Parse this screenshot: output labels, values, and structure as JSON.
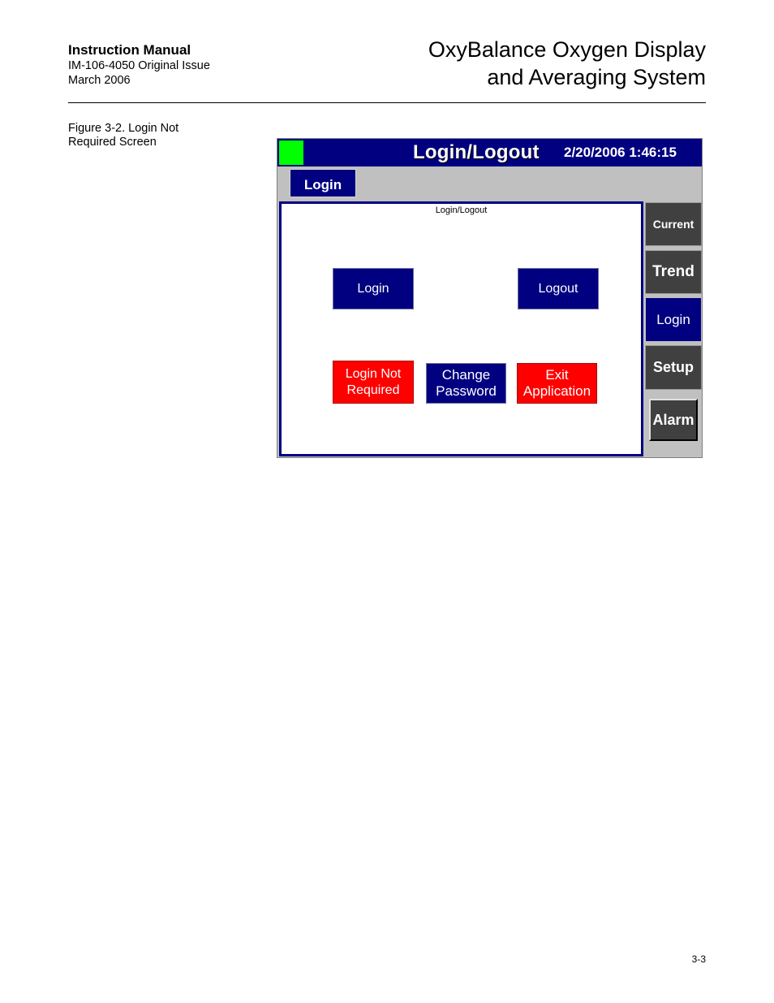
{
  "header": {
    "manual": "Instruction Manual",
    "doc_id": "IM-106-4050 Original Issue",
    "date": "March 2006",
    "title_line1": "OxyBalance Oxygen Display",
    "title_line2": "and Averaging System"
  },
  "figure": {
    "caption_line1": "Figure 3-2. Login Not",
    "caption_line2": "Required Screen"
  },
  "screen": {
    "title": "Login/Logout",
    "datetime": "2/20/2006 1:46:15",
    "tab_label": "Login",
    "panel_title": "Login/Logout",
    "buttons": {
      "login": "Login",
      "logout": "Logout",
      "login_not_required_1": "Login Not",
      "login_not_required_2": "Required",
      "change_password_1": "Change",
      "change_password_2": "Password",
      "exit_application_1": "Exit",
      "exit_application_2": "Application"
    },
    "nav": {
      "current": "Current",
      "trend": "Trend",
      "login": "Login",
      "setup": "Setup",
      "alarm": "Alarm"
    },
    "colors": {
      "titlebar": "#000080",
      "status": "#00ff00",
      "button_blue": "#000080",
      "button_red": "#ff0000"
    }
  },
  "page_number": "3-3"
}
